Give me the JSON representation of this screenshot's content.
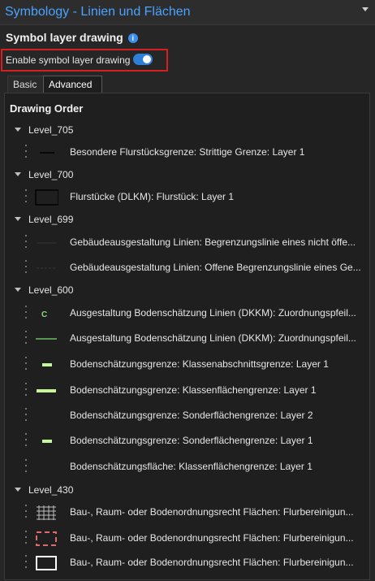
{
  "header": {
    "title": "Symbology - Linien und Flächen",
    "section": "Symbol layer drawing",
    "enable_label": "Enable symbol layer drawing",
    "toggle_on": true
  },
  "tabs": [
    {
      "label": "Basic",
      "active": false
    },
    {
      "label": "Advanced",
      "active": true
    }
  ],
  "drawing_order": "Drawing Order",
  "levels": [
    {
      "label": "Level_705"
    },
    {
      "label": "Level_700"
    },
    {
      "label": "Level_699"
    },
    {
      "label": "Level_600"
    },
    {
      "label": "Level_430"
    }
  ],
  "items": [
    {
      "label": "Besondere Flurstücksgrenze: Strittige Grenze: Layer 1",
      "symbol": "solid-black-line"
    },
    {
      "label": "Flurstücke (DLKM): Flurstück: Layer 1",
      "symbol": "black-rectangle"
    },
    {
      "label": "Gebäudeausgestaltung Linien: Begrenzungslinie eines nicht öffe...",
      "symbol": "gray-solid-line"
    },
    {
      "label": "Gebäudeausgestaltung Linien: Offene Begrenzungslinie eines Ge...",
      "symbol": "gray-dashed-line"
    },
    {
      "label": "Ausgestaltung Bodenschätzung Linien (DKKM): Zuordnungspfeil...",
      "symbol": "green-c"
    },
    {
      "label": "Ausgestaltung Bodenschätzung Linien (DKKM): Zuordnungspfeil...",
      "symbol": "green-thin-line"
    },
    {
      "label": "Bodenschätzungsgrenze: Klassenabschnittsgrenze: Layer 1",
      "symbol": "light-green-short-bar"
    },
    {
      "label": "Bodenschätzungsgrenze: Klassenflächengrenze: Layer 1",
      "symbol": "light-green-long-bar"
    },
    {
      "label": "Bodenschätzungsgrenze: Sonderflächengrenze: Layer 2",
      "symbol": "none"
    },
    {
      "label": "Bodenschätzungsgrenze: Sonderflächengrenze: Layer 1",
      "symbol": "light-green-short-bar"
    },
    {
      "label": "Bodenschätzungsfläche: Klassenflächengrenze: Layer 1",
      "symbol": "none"
    },
    {
      "label": "Bau-, Raum- oder Bodenordnungsrecht Flächen: Flurbereinigun...",
      "symbol": "hatched-pattern"
    },
    {
      "label": "Bau-, Raum- oder Bodenordnungsrecht Flächen: Flurbereinigun...",
      "symbol": "red-dashed-rectangle"
    },
    {
      "label": "Bau-, Raum- oder Bodenordnungsrecht Flächen: Flurbereinigun...",
      "symbol": "white-rectangle"
    }
  ],
  "colors": {
    "title": "#4aa3ff",
    "highlight_box": "#d81f1f",
    "toggle": "#2f7fd6",
    "light_green": "#c7f59a",
    "green": "#6dbb63",
    "red_dash": "#e06a6a"
  }
}
